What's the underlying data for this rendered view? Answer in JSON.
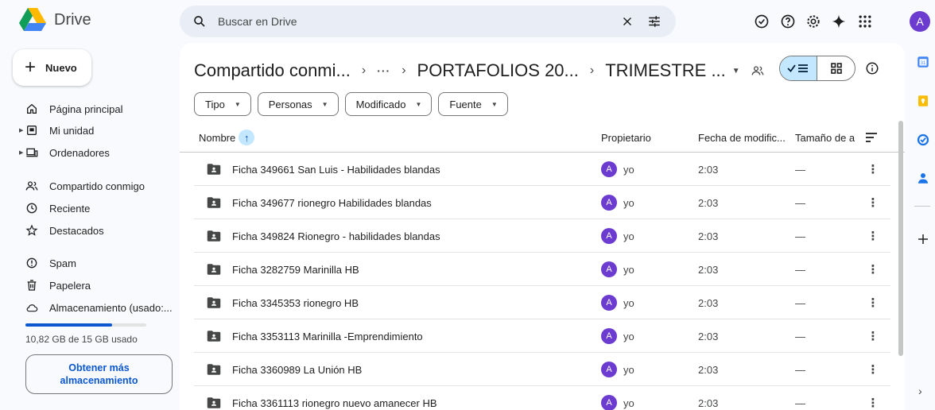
{
  "app": {
    "name": "Drive",
    "user_initial": "A"
  },
  "search": {
    "placeholder": "Buscar en Drive"
  },
  "sidebar": {
    "new_label": "Nuevo",
    "items": [
      {
        "label": "Página principal",
        "icon": "home-icon"
      },
      {
        "label": "Mi unidad",
        "icon": "my-drive-icon",
        "expandable": true
      },
      {
        "label": "Ordenadores",
        "icon": "computer-icon",
        "expandable": true
      },
      {
        "label": "Compartido conmigo",
        "icon": "people-icon"
      },
      {
        "label": "Reciente",
        "icon": "clock-icon"
      },
      {
        "label": "Destacados",
        "icon": "star-icon"
      },
      {
        "label": "Spam",
        "icon": "spam-icon"
      },
      {
        "label": "Papelera",
        "icon": "trash-icon"
      },
      {
        "label": "Almacenamiento (usado:...",
        "icon": "cloud-icon"
      }
    ],
    "storage": {
      "used_text": "10,82 GB de 15 GB usado",
      "used_fraction": 0.72,
      "button_label_line1": "Obtener más",
      "button_label_line2": "almacenamiento"
    }
  },
  "breadcrumb": {
    "root": "Compartido conmi...",
    "dots": "···",
    "middle": "PORTAFOLIOS 20...",
    "current": "TRIMESTRE ..."
  },
  "filters": [
    "Tipo",
    "Personas",
    "Modificado",
    "Fuente"
  ],
  "table": {
    "columns": {
      "name": "Nombre",
      "owner": "Propietario",
      "modified": "Fecha de modific...",
      "size": "Tamaño de a"
    },
    "rows": [
      {
        "name": "Ficha 349661 San Luis - Habilidades blandas",
        "owner_initial": "A",
        "owner": "yo",
        "modified": "2:03",
        "size": "—"
      },
      {
        "name": "Ficha 349677 rionegro Habilidades blandas",
        "owner_initial": "A",
        "owner": "yo",
        "modified": "2:03",
        "size": "—"
      },
      {
        "name": "Ficha 349824 Rionegro - habilidades blandas",
        "owner_initial": "A",
        "owner": "yo",
        "modified": "2:03",
        "size": "—"
      },
      {
        "name": "Ficha 3282759 Marinilla HB",
        "owner_initial": "A",
        "owner": "yo",
        "modified": "2:03",
        "size": "—"
      },
      {
        "name": "Ficha 3345353 rionegro HB",
        "owner_initial": "A",
        "owner": "yo",
        "modified": "2:03",
        "size": "—"
      },
      {
        "name": "Ficha 3353113 Marinilla -Emprendimiento",
        "owner_initial": "A",
        "owner": "yo",
        "modified": "2:03",
        "size": "—"
      },
      {
        "name": "Ficha 3360989 La Unión HB",
        "owner_initial": "A",
        "owner": "yo",
        "modified": "2:03",
        "size": "—"
      },
      {
        "name": "Ficha 3361113 rionegro nuevo amanecer HB",
        "owner_initial": "A",
        "owner": "yo",
        "modified": "2:03",
        "size": "—"
      }
    ]
  },
  "colors": {
    "accent": "#0b57d0",
    "selected": "#c2e7ff",
    "avatar": "#6c3bd0",
    "background": "#f8fafd"
  }
}
